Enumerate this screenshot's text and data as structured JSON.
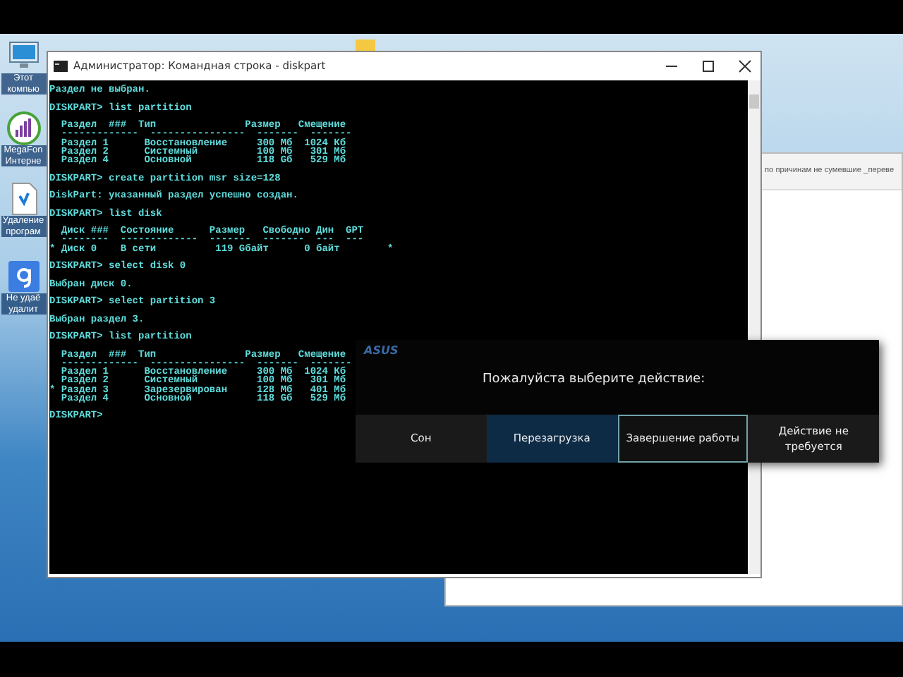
{
  "desktop_icons": [
    {
      "kind": "monitor",
      "label": "Этот компью"
    },
    {
      "kind": "chart",
      "label": "MegaFon Интерне"
    },
    {
      "kind": "document",
      "label": "Удаление програм"
    },
    {
      "kind": "google",
      "label": "Не удаё удалит"
    }
  ],
  "background_window": {
    "text": "по причинам не сумевшие _переве"
  },
  "console_window": {
    "title": "Администратор: Командная строка - diskpart",
    "blocks": [
      [
        "Раздел не выбран."
      ],
      [
        "DISKPART> list partition"
      ],
      [
        "  Раздел  ###  Тип               Размер   Смещение",
        "  -------------  ----------------  -------  -------",
        "  Раздел 1      Восстановление     300 Мб  1024 Кб",
        "  Раздел 2      Системный          100 Мб   301 Мб",
        "  Раздел 4      Основной           118 Gб   529 Мб"
      ],
      [
        "DISKPART> create partition msr size=128"
      ],
      [
        "DiskPart: указанный раздел успешно создан."
      ],
      [
        "DISKPART> list disk"
      ],
      [
        "  Диск ###  Состояние      Размер   Свободно Дин  GPT",
        "  --------  -------------  -------  -------  ---  ---",
        "* Диск 0    В сети          119 Gбайт      0 байт        *"
      ],
      [
        "DISKPART> select disk 0"
      ],
      [
        "Выбран диск 0."
      ],
      [
        "DISKPART> select partition 3"
      ],
      [
        "Выбран раздел 3."
      ],
      [
        "DISKPART> list partition"
      ],
      [
        "  Раздел  ###  Тип               Размер   Смещение",
        "  -------------  ----------------  -------  -------",
        "  Раздел 1      Восстановление     300 Мб  1024 Кб",
        "  Раздел 2      Системный          100 Мб   301 Мб",
        "* Раздел 3      Зарезервирован     128 Мб   401 Мб",
        "  Раздел 4      Основной           118 Gб   529 Мб"
      ],
      [
        "DISKPART>"
      ]
    ]
  },
  "shutdown_dialog": {
    "logo": "ASUS",
    "prompt": "Пожалуйста выберите действие:",
    "actions": [
      {
        "label": "Сон",
        "selected": false,
        "focused": false
      },
      {
        "label": "Перезагрузка",
        "selected": true,
        "focused": false
      },
      {
        "label": "Завершение работы",
        "selected": false,
        "focused": true
      },
      {
        "label": "Действие не требуется",
        "selected": false,
        "focused": false
      }
    ]
  }
}
